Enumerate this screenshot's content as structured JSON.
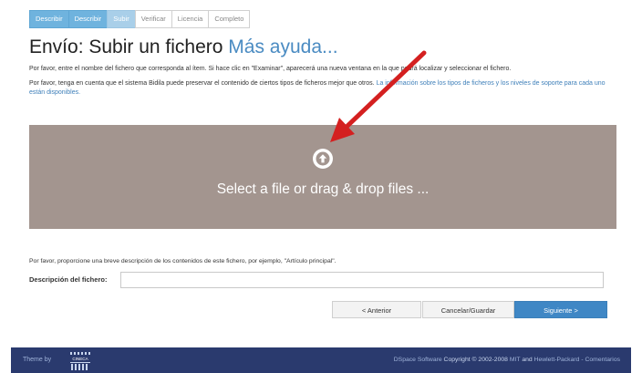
{
  "steps": [
    "Describir",
    "Describir",
    "Subir",
    "Verificar",
    "Licencia",
    "Completo"
  ],
  "page": {
    "title": "Envío: Subir un fichero",
    "help_link": "Más ayuda..."
  },
  "instructions": {
    "p1": "Por favor, entre el nombre del fichero que corresponda al ítem. Si hace clic en \"Examinar\", aparecerá una nueva ventana en la que podrá localizar y seleccionar el fichero.",
    "p2_text": "Por favor, tenga en cuenta que el sistema Bidila puede preservar el contenido de ciertos tipos de ficheros mejor que otros.",
    "p2_link": "La información sobre los tipos de ficheros y los niveles de soporte para cada uno están disponibles."
  },
  "dropzone": {
    "text": "Select a file or drag & drop files ...",
    "icon": "upload-circle-icon"
  },
  "description": {
    "hint": "Por favor, proporcione una breve descripción de los contenidos de este fichero, por ejemplo, \"Artículo principal\".",
    "label": "Descripción del fichero:",
    "value": ""
  },
  "buttons": {
    "previous": "< Anterior",
    "cancel": "Cancelar/Guardar",
    "next": "Siguiente >"
  },
  "footer": {
    "theme_by": "Theme by",
    "logo_text": "CINECA",
    "dspace": "DSpace Software",
    "copyright": "Copyright © 2002-2008",
    "mit": "MIT",
    "and": "and",
    "hp": "Hewlett-Packard",
    "dash": "-",
    "comments": "Comentarios"
  },
  "colors": {
    "accent": "#3f87c5",
    "dropzone": "#a3958f",
    "footer": "#2a3a6e",
    "arrow": "#d42020"
  }
}
